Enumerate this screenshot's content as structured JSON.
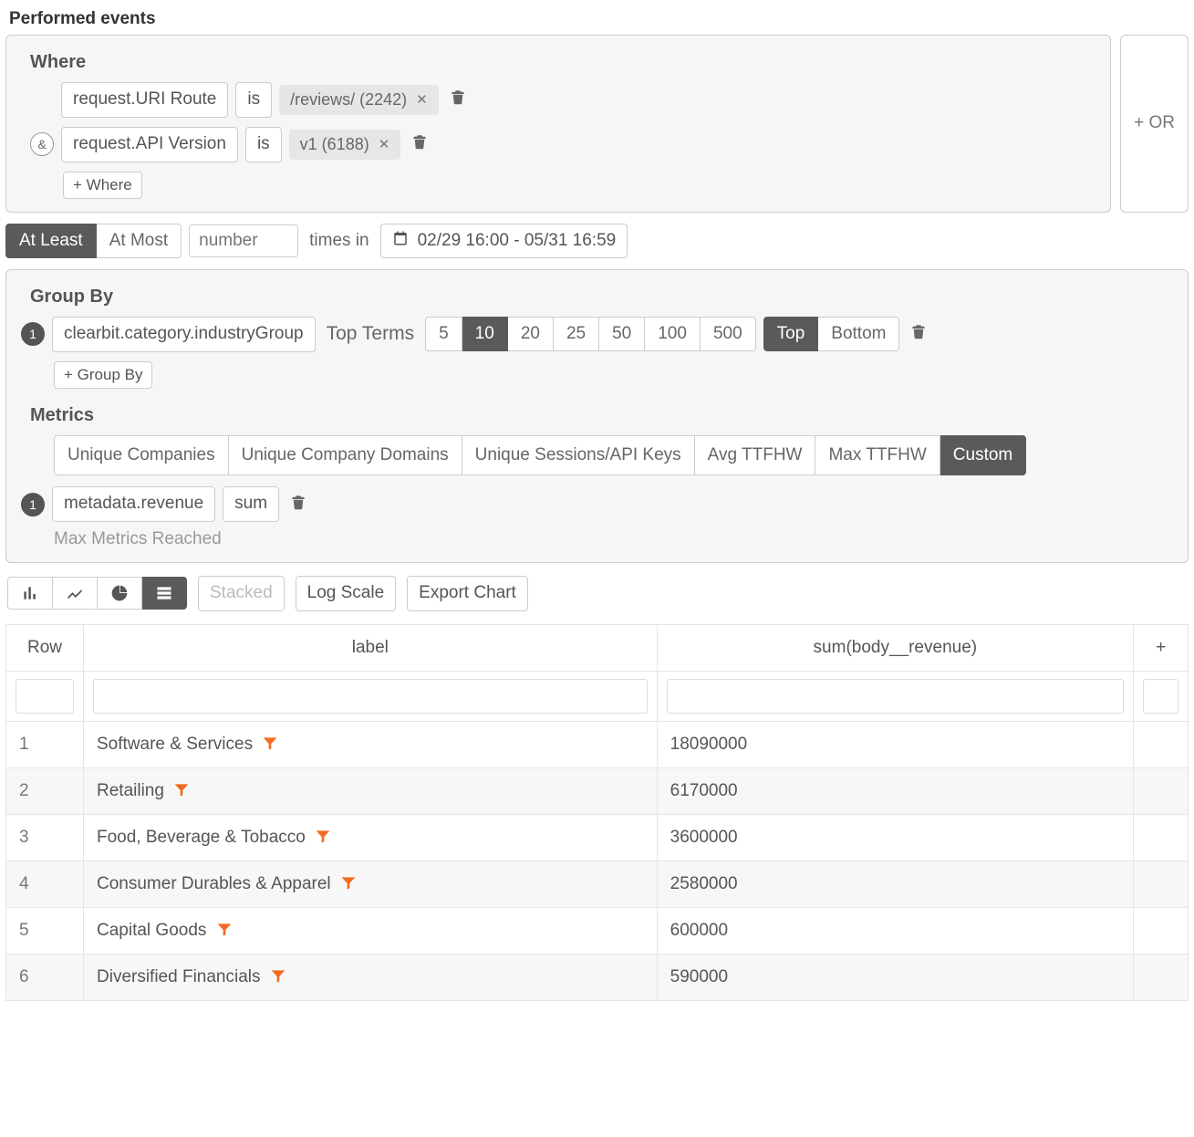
{
  "header": {
    "performed_events": "Performed events"
  },
  "where": {
    "title": "Where",
    "and_symbol": "&",
    "rows": [
      {
        "field": "request.URI Route",
        "op": "is",
        "chip": "/reviews/ (2242)"
      },
      {
        "field": "request.API Version",
        "op": "is",
        "chip": "v1 (6188)"
      }
    ],
    "add_where": "+ Where",
    "or_label": "+ OR"
  },
  "frequency": {
    "at_least": "At Least",
    "at_most": "At Most",
    "number_placeholder": "number",
    "times_in": "times in",
    "date_range": "02/29 16:00 - 05/31 16:59"
  },
  "group_by": {
    "title": "Group By",
    "badge": "1",
    "field": "clearbit.category.industryGroup",
    "top_terms_label": "Top Terms",
    "counts": [
      "5",
      "10",
      "20",
      "25",
      "50",
      "100",
      "500"
    ],
    "counts_active": "10",
    "top": "Top",
    "bottom": "Bottom",
    "add": "+ Group By"
  },
  "metrics": {
    "title": "Metrics",
    "options": [
      "Unique Companies",
      "Unique Company Domains",
      "Unique Sessions/API Keys",
      "Avg TTFHW",
      "Max TTFHW",
      "Custom"
    ],
    "options_active": "Custom",
    "badge": "1",
    "field": "metadata.revenue",
    "agg": "sum",
    "max_reached": "Max Metrics Reached"
  },
  "toolbar": {
    "stacked": "Stacked",
    "log_scale": "Log Scale",
    "export": "Export Chart"
  },
  "table": {
    "headers": {
      "row": "Row",
      "label": "label",
      "value": "sum(body__revenue)",
      "plus": "+"
    },
    "rows": [
      {
        "n": "1",
        "label": "Software & Services",
        "value": "18090000"
      },
      {
        "n": "2",
        "label": "Retailing",
        "value": "6170000"
      },
      {
        "n": "3",
        "label": "Food, Beverage & Tobacco",
        "value": "3600000"
      },
      {
        "n": "4",
        "label": "Consumer Durables & Apparel",
        "value": "2580000"
      },
      {
        "n": "5",
        "label": "Capital Goods",
        "value": "600000"
      },
      {
        "n": "6",
        "label": "Diversified Financials",
        "value": "590000"
      }
    ]
  }
}
